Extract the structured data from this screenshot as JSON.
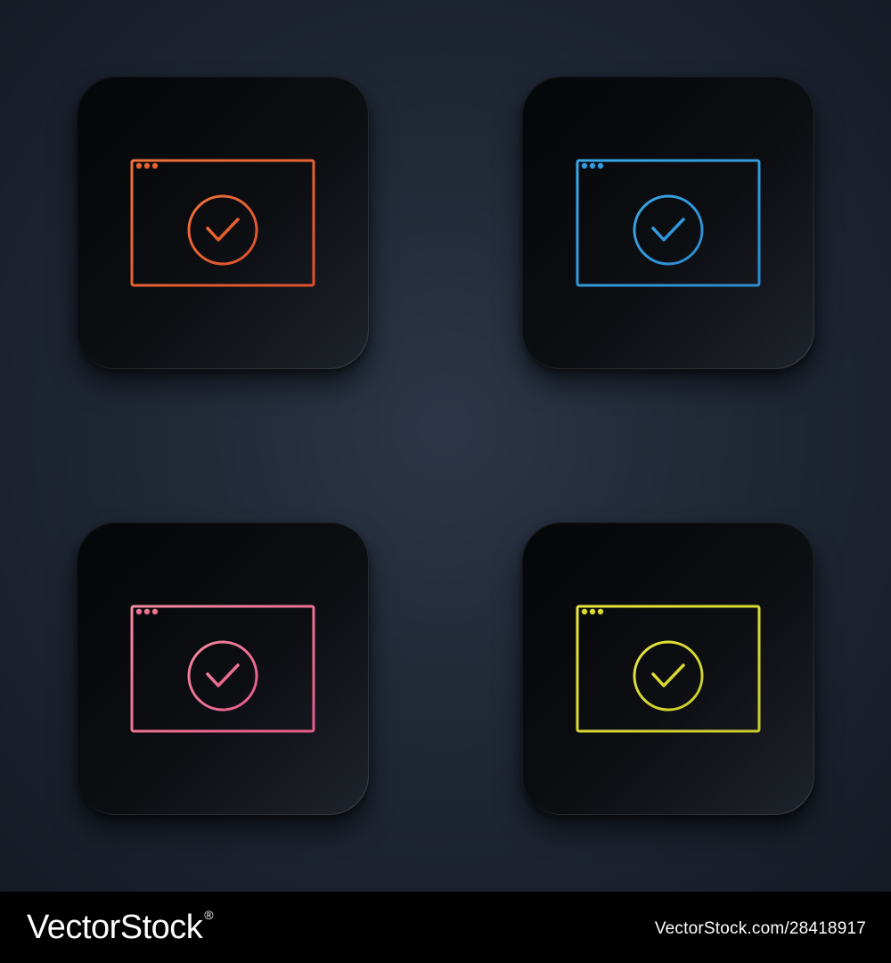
{
  "icons": [
    {
      "name": "browser-check-icon",
      "stroke_start": "#f0723a",
      "stroke_end": "#e0502a"
    },
    {
      "name": "browser-check-icon",
      "stroke_start": "#3aa8e8",
      "stroke_end": "#2b8ad0"
    },
    {
      "name": "browser-check-icon",
      "stroke_start": "#f48aa0",
      "stroke_end": "#e65a88"
    },
    {
      "name": "browser-check-icon",
      "stroke_start": "#e8e63a",
      "stroke_end": "#c8cc2a"
    }
  ],
  "footer": {
    "brand": "VectorStock",
    "brand_mark": "®",
    "image_id": "VectorStock.com/28418917"
  }
}
